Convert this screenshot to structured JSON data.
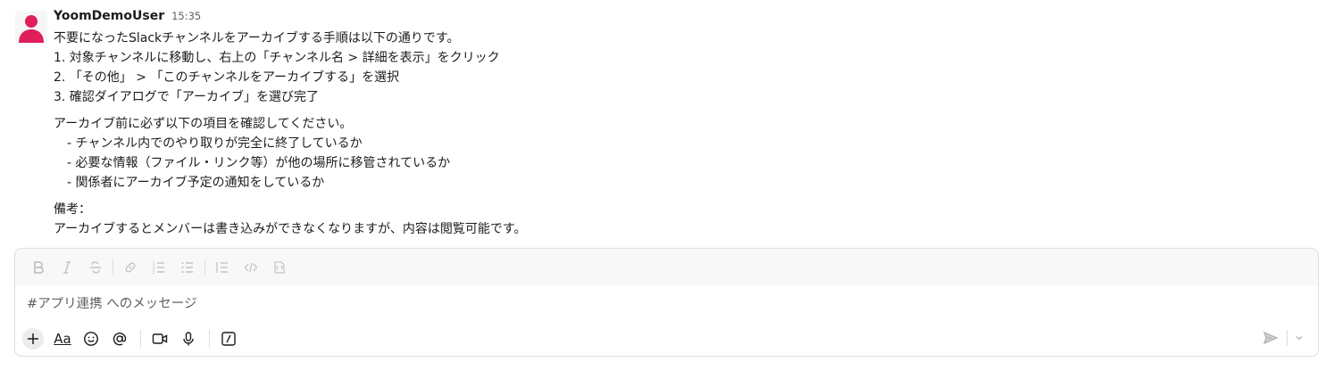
{
  "message": {
    "username": "YoomDemoUser",
    "timestamp": "15:35",
    "lines": [
      "不要になったSlackチャンネルをアーカイブする手順は以下の通りです。",
      "1. 対象チャンネルに移動し、右上の「チャンネル名 > 詳細を表示」をクリック",
      "2. 「その他」 > 「このチャンネルをアーカイブする」を選択",
      "3. 確認ダイアログで「アーカイブ」を選び完了",
      "アーカイブ前に必ず以下の項目を確認してください。",
      "- チャンネル内でのやり取りが完全に終了しているか",
      "- 必要な情報（ファイル・リンク等）が他の場所に移管されているか",
      "- 関係者にアーカイブ予定の通知をしているか",
      "備考：",
      "アーカイブするとメンバーは書き込みができなくなりますが、内容は閲覧可能です。"
    ]
  },
  "composer": {
    "placeholder": "#アプリ連携 へのメッセージ",
    "format_icons": [
      "bold-icon",
      "italic-icon",
      "strikethrough-icon",
      "link-icon",
      "ordered-list-icon",
      "bulleted-list-icon",
      "blockquote-icon",
      "code-icon",
      "code-block-icon"
    ],
    "action_icons": [
      "plus-icon",
      "text-format-icon",
      "emoji-icon",
      "mention-icon",
      "video-icon",
      "microphone-icon",
      "slash-command-icon"
    ],
    "text_format_label": "Aa"
  },
  "colors": {
    "avatar_accent": "#e01e5a",
    "text": "#1d1c1d",
    "muted": "#616061",
    "border": "#dddddd"
  }
}
